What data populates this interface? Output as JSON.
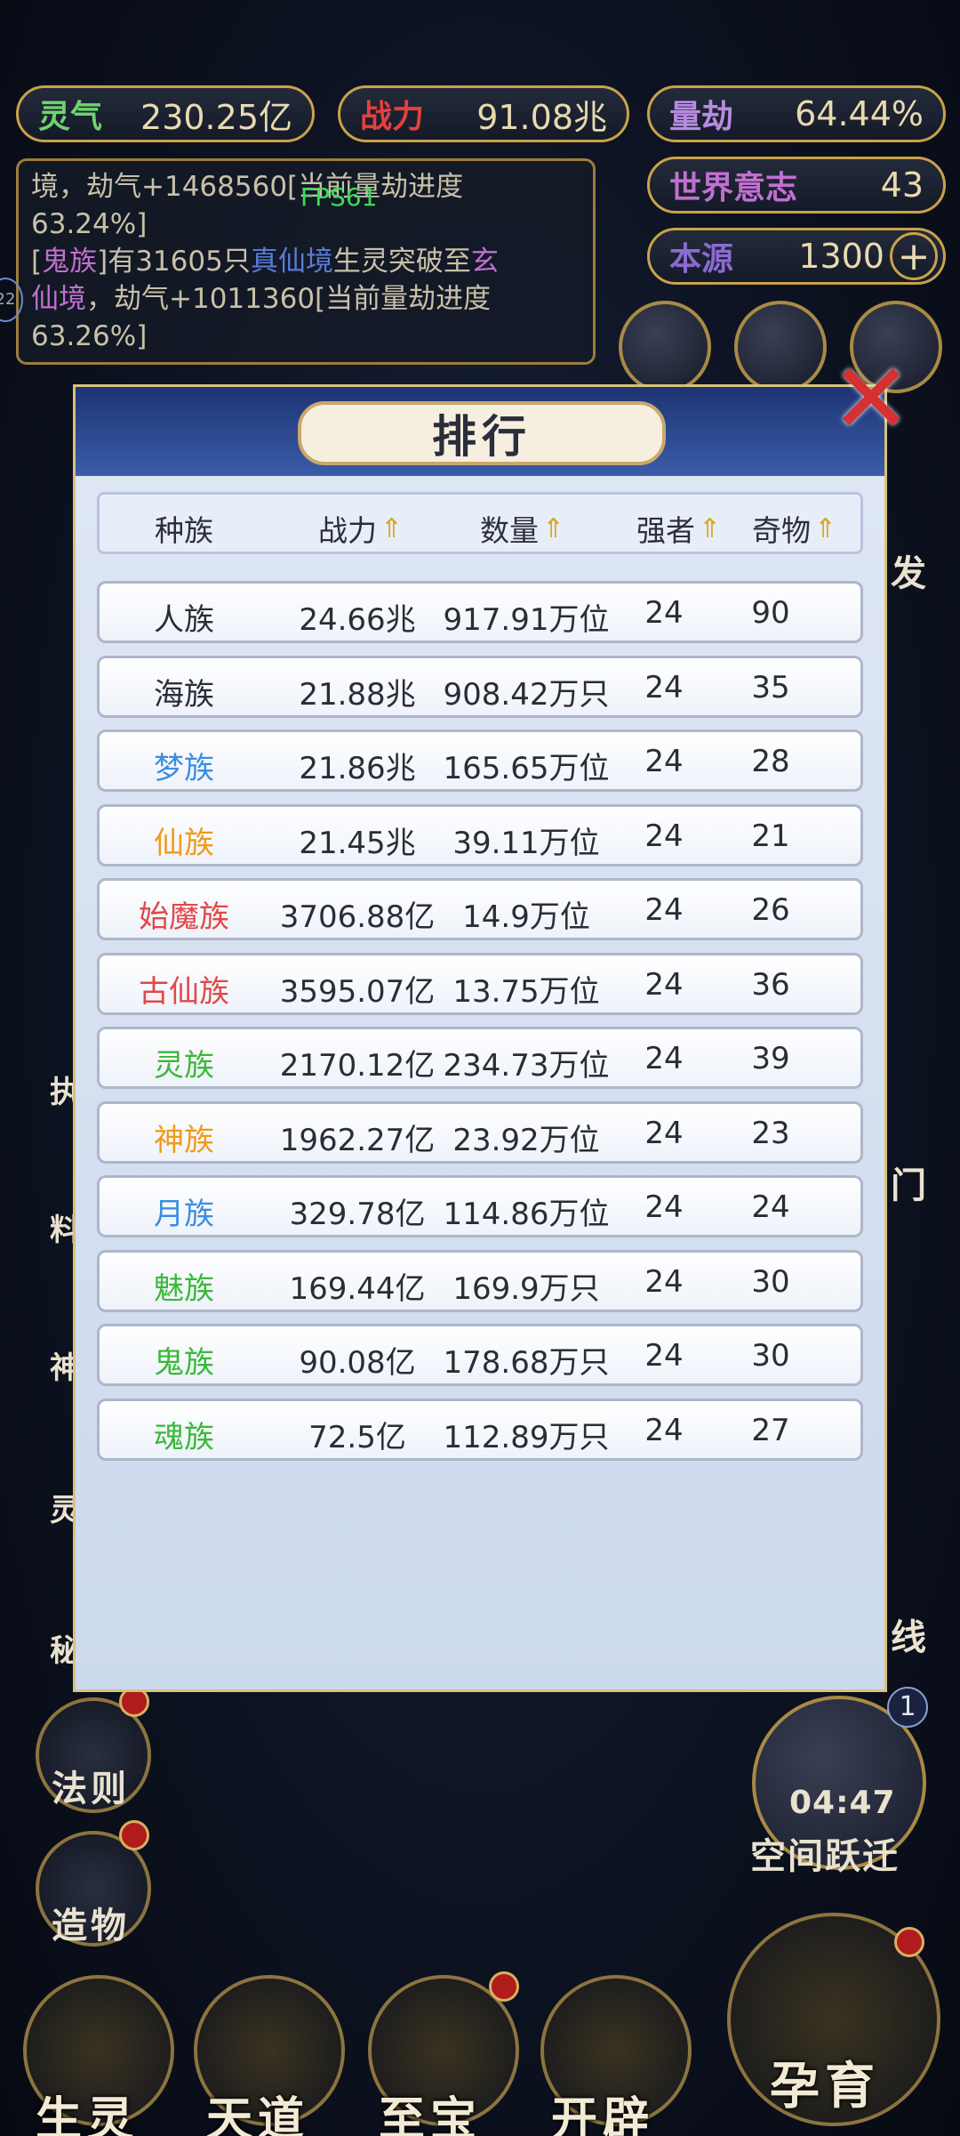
{
  "hud": {
    "lingqi": {
      "label": "灵气",
      "value": "230.25亿"
    },
    "zhanli": {
      "label": "战力",
      "value": "91.08兆"
    },
    "liangjie": {
      "label": "量劫",
      "value": "64.44%"
    },
    "shijie": {
      "label": "世界意志",
      "value": "43"
    },
    "benyuan": {
      "label": "本源",
      "value": "1300",
      "plus": "+"
    },
    "fps": "FPS61",
    "level_badge": "22"
  },
  "log": {
    "line1a": "境，劫气+1468560[当前量劫进度",
    "line1b": "63.24%]",
    "line2_open": "[",
    "line2_race": "鬼族",
    "line2_mid": "]有31605只",
    "line2_realm": "真仙境",
    "line2_rest": "生灵突破至",
    "line2_target": "玄",
    "line3_target": "仙境",
    "line3_rest": "，劫气+1011360[当前量劫进度",
    "line4": "63.26%]"
  },
  "panel": {
    "title": "排行",
    "close": "✕",
    "headers": [
      "种族",
      "战力",
      "数量",
      "强者",
      "奇物"
    ],
    "arrow": "⇑",
    "rows": [
      {
        "race": "人族",
        "power": "24.66兆",
        "count": "917.91万位",
        "strong": "24",
        "items": "90",
        "color": "#2b2d35"
      },
      {
        "race": "海族",
        "power": "21.88兆",
        "count": "908.42万只",
        "strong": "24",
        "items": "35",
        "color": "#2b2d35"
      },
      {
        "race": "梦族",
        "power": "21.86兆",
        "count": "165.65万位",
        "strong": "24",
        "items": "28",
        "color": "#3a8ee0"
      },
      {
        "race": "仙族",
        "power": "21.45兆",
        "count": "39.11万位",
        "strong": "24",
        "items": "21",
        "color": "#f09a1a"
      },
      {
        "race": "始魔族",
        "power": "3706.88亿",
        "count": "14.9万位",
        "strong": "24",
        "items": "26",
        "color": "#e24848"
      },
      {
        "race": "古仙族",
        "power": "3595.07亿",
        "count": "13.75万位",
        "strong": "24",
        "items": "36",
        "color": "#e24848"
      },
      {
        "race": "灵族",
        "power": "2170.12亿",
        "count": "234.73万位",
        "strong": "24",
        "items": "39",
        "color": "#3ab83a"
      },
      {
        "race": "神族",
        "power": "1962.27亿",
        "count": "23.92万位",
        "strong": "24",
        "items": "23",
        "color": "#f09a1a"
      },
      {
        "race": "月族",
        "power": "329.78亿",
        "count": "114.86万位",
        "strong": "24",
        "items": "24",
        "color": "#3a8ee0"
      },
      {
        "race": "魅族",
        "power": "169.44亿",
        "count": "169.9万只",
        "strong": "24",
        "items": "30",
        "color": "#3ab83a"
      },
      {
        "race": "鬼族",
        "power": "90.08亿",
        "count": "178.68万只",
        "strong": "24",
        "items": "30",
        "color": "#3ab83a"
      },
      {
        "race": "魂族",
        "power": "72.5亿",
        "count": "112.89万只",
        "strong": "24",
        "items": "27",
        "color": "#3ab83a"
      }
    ]
  },
  "side": {
    "faze": "法则",
    "zaowu": "造物",
    "kongjian": "空间跃迁",
    "timer": "04:47",
    "badge": "1",
    "fa": "发",
    "men": "门",
    "xian": "线",
    "left_partials": [
      "执",
      "料",
      "神",
      "灵",
      "秘"
    ]
  },
  "bottom": {
    "shengling": "生灵",
    "tiandao": "天道",
    "zhibao": "至宝",
    "kaipi": "开辟",
    "yunyu": "孕育"
  }
}
